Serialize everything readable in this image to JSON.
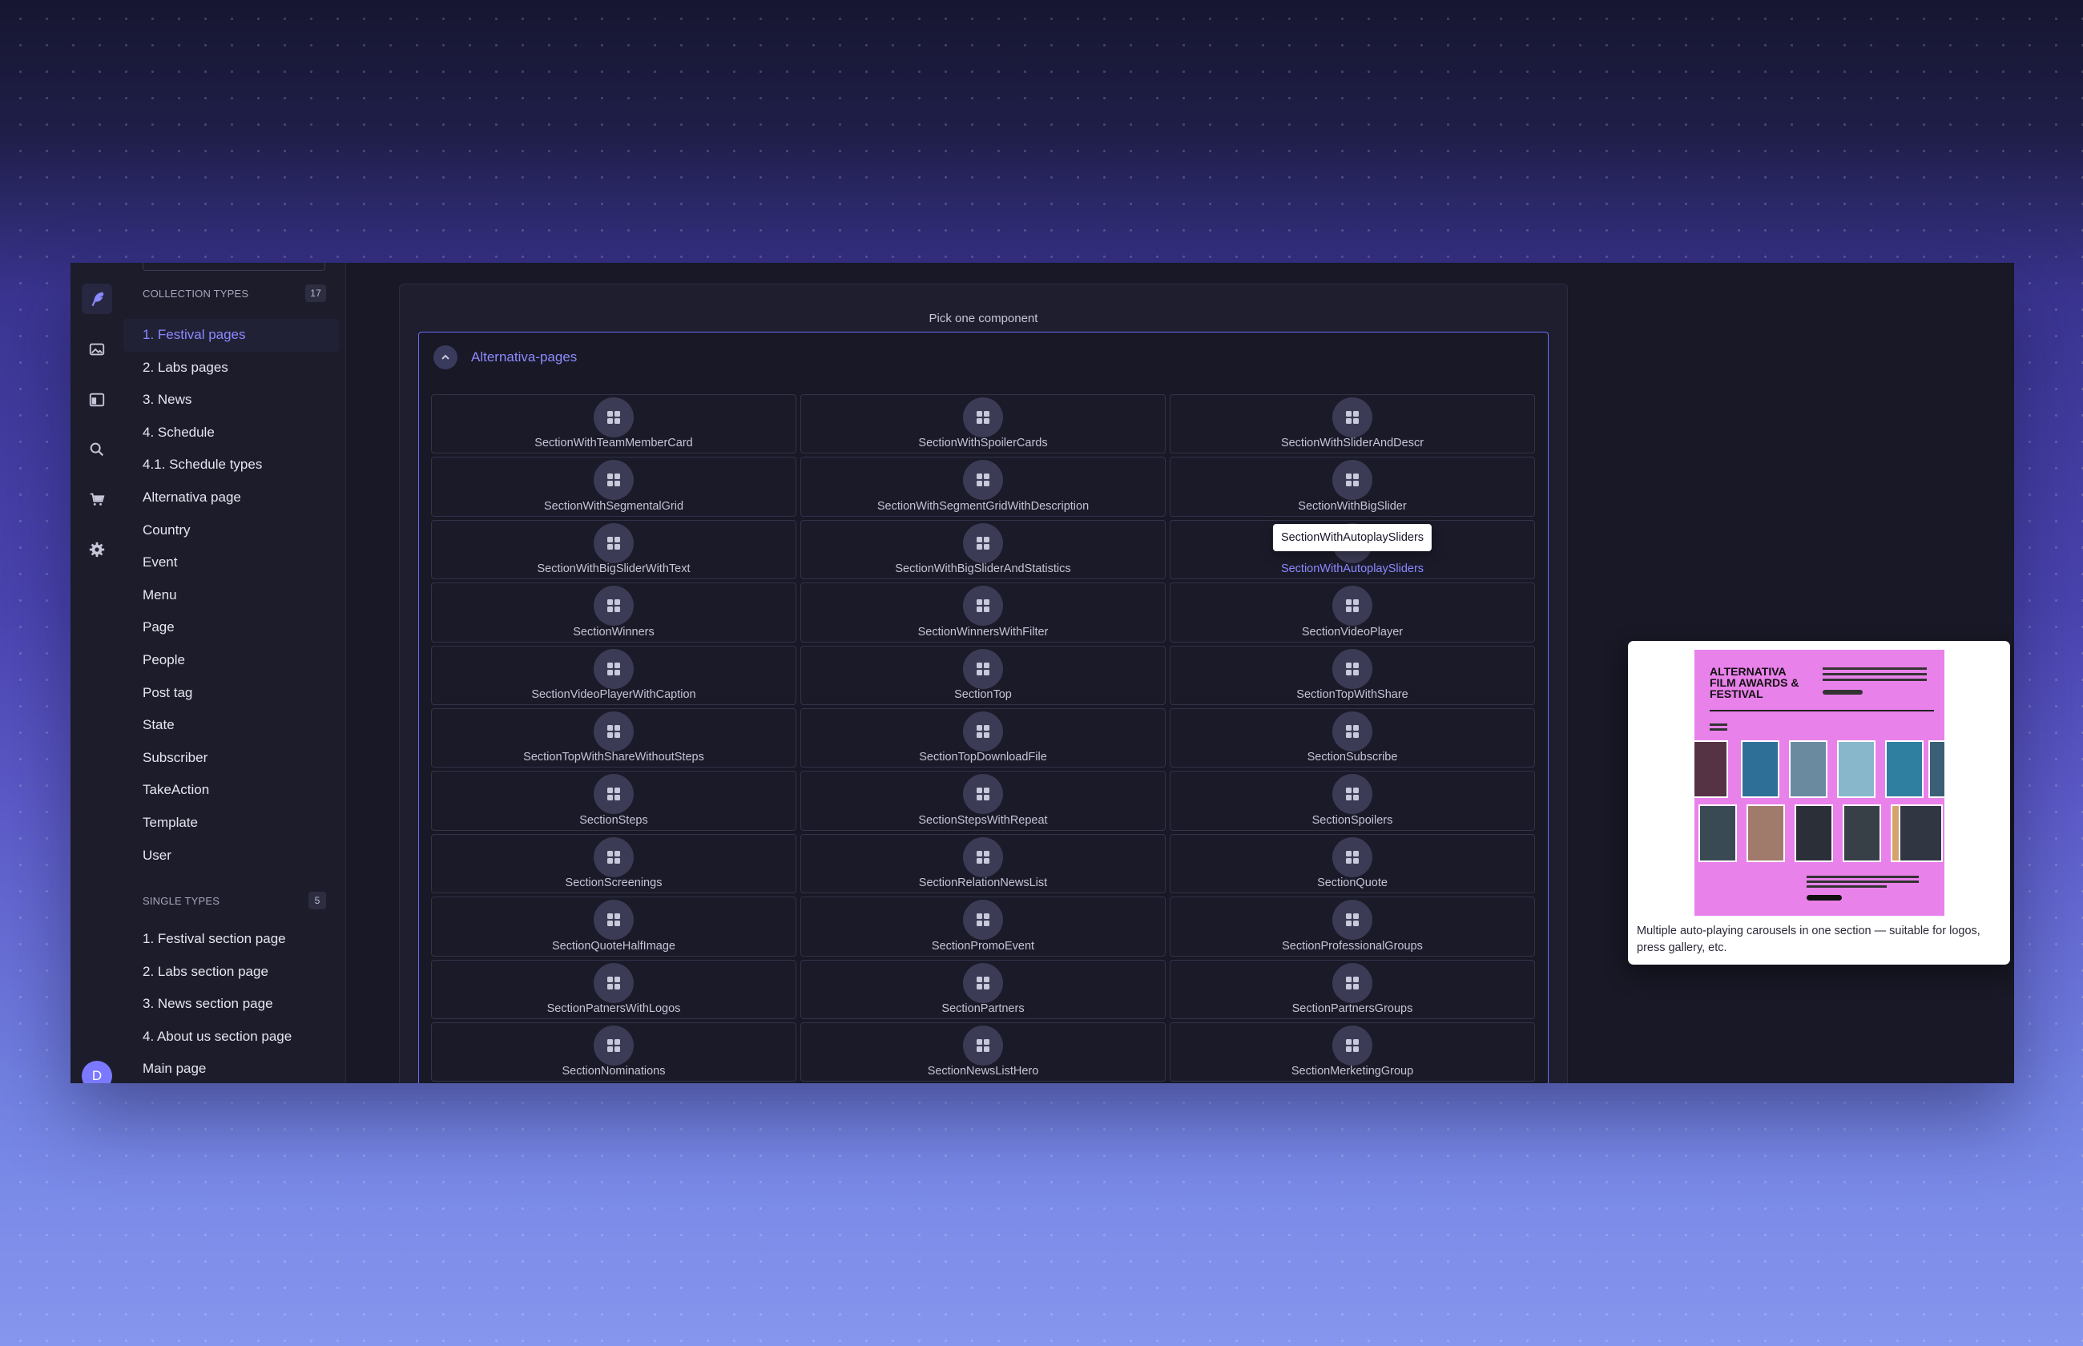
{
  "sidebar": {
    "collection_header": "COLLECTION TYPES",
    "collection_count": "17",
    "collection_items": [
      {
        "label": "1. Festival pages",
        "active": true
      },
      {
        "label": "2. Labs pages"
      },
      {
        "label": "3. News"
      },
      {
        "label": "4. Schedule"
      },
      {
        "label": "4.1. Schedule types"
      },
      {
        "label": "Alternativa page"
      },
      {
        "label": "Country"
      },
      {
        "label": "Event"
      },
      {
        "label": "Menu"
      },
      {
        "label": "Page"
      },
      {
        "label": "People"
      },
      {
        "label": "Post tag"
      },
      {
        "label": "State"
      },
      {
        "label": "Subscriber"
      },
      {
        "label": "TakeAction"
      },
      {
        "label": "Template"
      },
      {
        "label": "User"
      }
    ],
    "single_header": "SINGLE TYPES",
    "single_count": "5",
    "single_items": [
      {
        "label": "1. Festival section page"
      },
      {
        "label": "2. Labs section page"
      },
      {
        "label": "3. News section page"
      },
      {
        "label": "4. About us section page"
      },
      {
        "label": "Main page"
      }
    ]
  },
  "rail": {
    "icons": [
      "feather-icon",
      "image-icon",
      "layout-icon",
      "search-icon",
      "cart-icon",
      "gear-icon"
    ],
    "avatar_initial": "D"
  },
  "picker": {
    "title": "Pick one component",
    "group_name": "Alternativa-pages",
    "components": [
      "SectionWithTeamMemberCard",
      "SectionWithSpoilerCards",
      "SectionWithSliderAndDescr",
      "SectionWithSegmentalGrid",
      "SectionWithSegmentGridWithDescription",
      "SectionWithBigSlider",
      "SectionWithBigSliderWithText",
      "SectionWithBigSliderAndStatistics",
      "SectionWithAutoplaySliders",
      "SectionWinners",
      "SectionWinnersWithFilter",
      "SectionVideoPlayer",
      "SectionVideoPlayerWithCaption",
      "SectionTop",
      "SectionTopWithShare",
      "SectionTopWithShareWithoutSteps",
      "SectionTopDownloadFile",
      "SectionSubscribe",
      "SectionSteps",
      "SectionStepsWithRepeat",
      "SectionSpoilers",
      "SectionScreenings",
      "SectionRelationNewsList",
      "SectionQuote",
      "SectionQuoteHalfImage",
      "SectionPromoEvent",
      "SectionProfessionalGroups",
      "SectionPatnersWithLogos",
      "SectionPartners",
      "SectionPartnersGroups",
      "SectionNominations",
      "SectionNewsListHero",
      "SectionMerketingGroup"
    ],
    "hovered_index": 8,
    "tooltip": "SectionWithAutoplaySliders"
  },
  "preview": {
    "thumb_title": "ALTERNATIVA FILM AWARDS & FESTIVAL",
    "description": "Multiple auto-playing carousels in one section — suitable for logos, press gallery, etc.",
    "accent_color": "#e981ea"
  },
  "colors": {
    "accent": "#8b89ff",
    "app_bg": "#181826"
  }
}
